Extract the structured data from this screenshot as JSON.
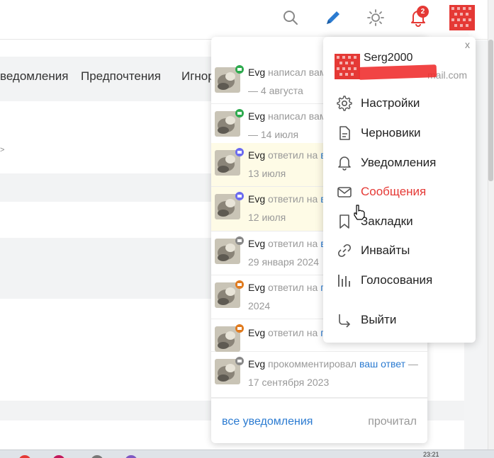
{
  "header": {
    "icons": [
      "search-icon",
      "pencil-icon",
      "sun-icon",
      "bell-icon",
      "avatar"
    ],
    "notification_count": "2",
    "accent_color": "#2b7bd1",
    "alert_color": "#e53935"
  },
  "tabs": [
    "ведомления",
    "Предпочтения",
    "Игнор"
  ],
  "notifications": [
    {
      "user": "Evg",
      "action": "написал вам",
      "link": "",
      "date": "— 4 августа",
      "type_icon": "mail-icon",
      "unread": false
    },
    {
      "user": "Evg",
      "action": "написал вам",
      "link": "",
      "date": "— 14 июля",
      "type_icon": "mail-icon",
      "unread": false
    },
    {
      "user": "Evg",
      "action": "ответил на",
      "link": "в",
      "date": "13 июля",
      "type_icon": "chat-icon",
      "unread": true
    },
    {
      "user": "Evg",
      "action": "ответил на",
      "link": "в",
      "date": "12 июля",
      "type_icon": "chat-icon",
      "unread": true
    },
    {
      "user": "Evg",
      "action": "ответил на",
      "link": "в",
      "date": "29 января 2024",
      "type_icon": "comment-icon",
      "unread": false
    },
    {
      "user": "Evg",
      "action": "ответил на",
      "link": "п",
      "date": "2024",
      "type_icon": "reply-icon",
      "unread": false
    },
    {
      "user": "Evg",
      "action": "ответил на",
      "link": "п",
      "date": "",
      "type_icon": "reply-icon",
      "unread": false
    },
    {
      "user": "Evg",
      "action": "прокомментировал",
      "link": "ваш ответ",
      "date": "—",
      "date2": "17 сентября 2023",
      "type_icon": "comment-icon",
      "unread": false
    }
  ],
  "notif_footer": {
    "all_label": "все уведомления",
    "read_label": "прочитал"
  },
  "user_menu": {
    "close_label": "x",
    "username": "Serg2000",
    "email": "mail.com",
    "items": [
      {
        "label": "Настройки",
        "icon": "gear-icon",
        "active": false
      },
      {
        "label": "Черновики",
        "icon": "document-icon",
        "active": false
      },
      {
        "label": "Уведомления",
        "icon": "bell-icon",
        "active": false
      },
      {
        "label": "Сообщения",
        "icon": "mail-icon",
        "active": true
      },
      {
        "label": "Закладки",
        "icon": "bookmark-icon",
        "active": false
      },
      {
        "label": "Инвайты",
        "icon": "link-icon",
        "active": false
      },
      {
        "label": "Голосования",
        "icon": "poll-icon",
        "active": false
      },
      {
        "label": "Выйти",
        "icon": "logout-icon",
        "active": false
      }
    ]
  },
  "taskbar": {
    "clock": "23:21"
  }
}
